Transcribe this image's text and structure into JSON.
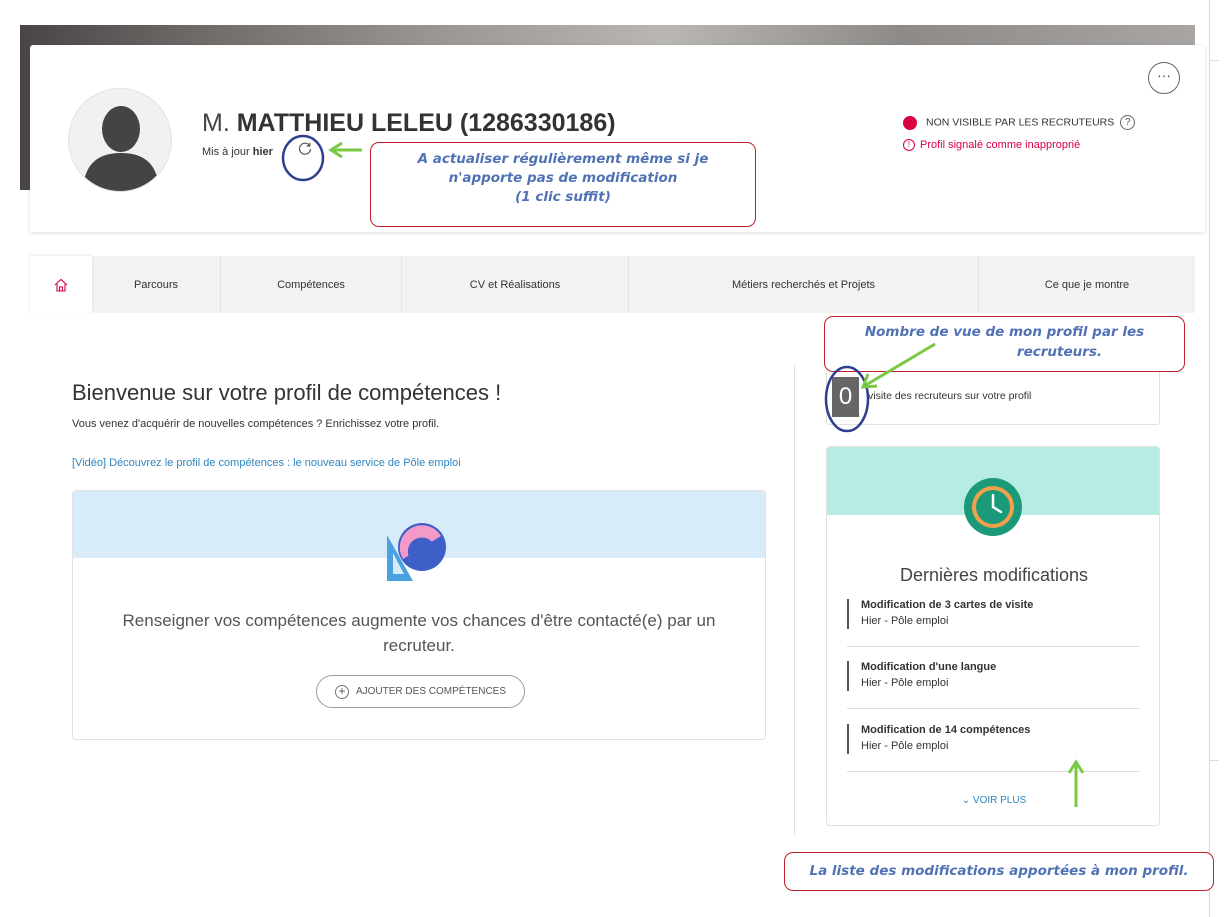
{
  "profile": {
    "civility": "M.",
    "name": "MATTHIEU LELEU (1286330186)",
    "updated_prefix": "Mis à jour",
    "updated_when": "hier",
    "visibility": "NON VISIBLE PAR LES RECRUTEURS",
    "flag": "Profil signalé comme inapproprié",
    "more_label": "···"
  },
  "tabs": [
    "Parcours",
    "Compétences",
    "CV et Réalisations",
    "Métiers recherchés et Projets",
    "Ce que je montre"
  ],
  "main": {
    "welcome": "Bienvenue sur votre profil de compétences !",
    "subtitle": "Vous venez d'acquérir de nouvelles compétences ? Enrichissez votre profil.",
    "video_link": "[Vidéo] Découvrez le profil de compétences : le nouveau service de Pôle emploi",
    "skills_text": "Renseigner vos compétences augmente vos chances d'être contacté(e) par un recruteur.",
    "add_button": "AJOUTER DES COMPÉTENCES"
  },
  "visits": {
    "count": "0",
    "label": "visite des recruteurs sur votre profil"
  },
  "modifications": {
    "title": "Dernières modifications",
    "items": [
      {
        "title": "Modification de 3 cartes de visite",
        "sub": "Hier - Pôle emploi"
      },
      {
        "title": "Modification d'une langue",
        "sub": "Hier - Pôle emploi"
      },
      {
        "title": "Modification de 14 compétences",
        "sub": "Hier - Pôle emploi"
      }
    ],
    "see_more": "VOIR PLUS"
  },
  "annotations": {
    "refresh_l1": "A actualiser régulièrement même si je",
    "refresh_l2": "n'apporte pas de modification",
    "refresh_l3": "(1 clic suffit)",
    "views_l1": "Nombre de vue de mon profil par les",
    "views_l2": "recruteurs.",
    "list_note": "La liste des modifications apportées à mon profil."
  },
  "colors": {
    "accent_red": "#d9003f",
    "link_blue": "#2e86c1",
    "annotation_text": "#5072b5",
    "annotation_border": "#c0202a",
    "arrow_green": "#7ac943",
    "circle_navy": "#2f3f8f",
    "mint": "#b6ece1",
    "skills_blue": "#d8ebf9"
  }
}
